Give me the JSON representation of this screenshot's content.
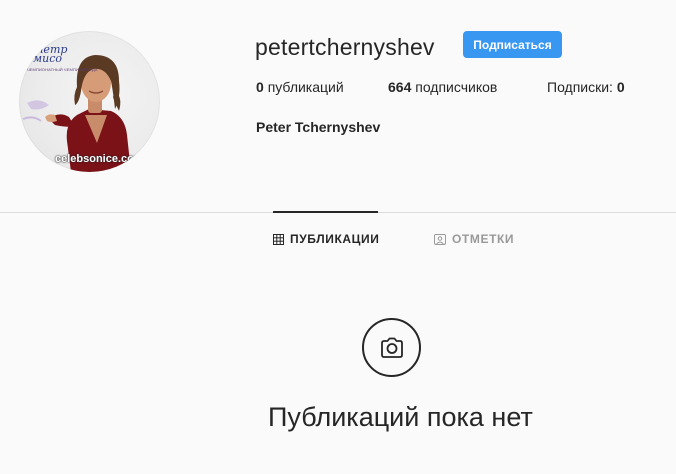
{
  "profile": {
    "username": "petertchernyshev",
    "follow_label": "Подписаться",
    "full_name": "Peter Tchernyshev",
    "avatar_text": {
      "logo": "тетр\nмисо",
      "subtitle": "ЧЕМПИОНАТНЫЙ ЧЕМПИОН СЕДА",
      "watermark": "celebsonice.com"
    }
  },
  "stats": {
    "posts": {
      "count": "0",
      "label": "публикаций"
    },
    "followers": {
      "count": "664",
      "label": "подписчиков"
    },
    "following": {
      "label": "Подписки:",
      "count": "0"
    }
  },
  "tabs": [
    {
      "label": "ПУБЛИКАЦИИ",
      "icon": "grid-icon",
      "active": true
    },
    {
      "label": "ОТМЕТКИ",
      "icon": "tagged-icon",
      "active": false
    }
  ],
  "empty_state": {
    "icon": "camera-icon",
    "text": "Публикаций пока нет"
  },
  "colors": {
    "background": "#fafafa",
    "accent": "#3897f0",
    "text": "#262626",
    "muted": "#999999",
    "divider": "#dbdbdb"
  }
}
